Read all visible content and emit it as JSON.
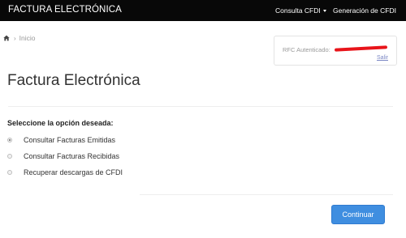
{
  "navbar": {
    "brand": "FACTURA ELECTRÓNICA",
    "menu_consulta": "Consulta CFDI",
    "menu_generacion": "Generación de CFDI"
  },
  "breadcrumb": {
    "home_icon": "home-icon",
    "item": "Inicio"
  },
  "auth": {
    "rfc_label": "RFC Autenticado:",
    "salir": "Salir"
  },
  "page": {
    "title": "Factura Electrónica",
    "prompt": "Seleccione la opción deseada:"
  },
  "options": [
    {
      "label": "Consultar Facturas Emitidas",
      "checked": true
    },
    {
      "label": "Consultar Facturas Recibidas",
      "checked": false
    },
    {
      "label": "Recuperar descargas de CFDI",
      "checked": false
    }
  ],
  "actions": {
    "continuar": "Continuar"
  },
  "colors": {
    "navbar": "#080808",
    "button": "#3f8ee0",
    "redaction": "#e8141a",
    "link": "#7a86c4"
  }
}
